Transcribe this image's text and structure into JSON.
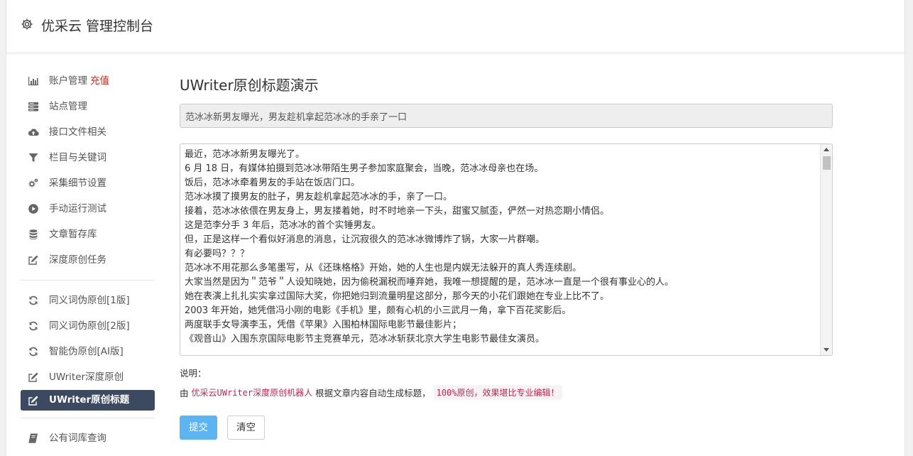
{
  "header": {
    "title": "优采云 管理控制台",
    "icon": "gear-icon"
  },
  "sidebar": {
    "items": [
      {
        "label": "账户管理",
        "tag": "充值",
        "icon": "bar-chart-icon"
      },
      {
        "label": "站点管理",
        "icon": "server-icon"
      },
      {
        "label": "接口文件相关",
        "icon": "cloud-upload-icon"
      },
      {
        "label": "栏目与关键词",
        "icon": "filter-icon"
      },
      {
        "label": "采集细节设置",
        "icon": "cogs-icon"
      },
      {
        "label": "手动运行测试",
        "icon": "play-circle-icon"
      },
      {
        "label": "文章暂存库",
        "icon": "database-icon"
      },
      {
        "label": "深度原创任务",
        "icon": "edit-icon"
      }
    ],
    "items2": [
      {
        "label": "同义词伪原创[1版]",
        "icon": "refresh-icon"
      },
      {
        "label": "同义词伪原创[2版]",
        "icon": "refresh-icon"
      },
      {
        "label": "智能伪原创[AI版]",
        "icon": "refresh-icon"
      },
      {
        "label": "UWriter深度原创",
        "icon": "edit-icon"
      },
      {
        "label": "UWriter原创标题",
        "icon": "edit-icon",
        "active": true
      }
    ],
    "items3": [
      {
        "label": "公有词库查询",
        "icon": "book-icon"
      }
    ]
  },
  "main": {
    "page_title": "UWriter原创标题演示",
    "generated_title": "范冰冰新男友曝光，男友趁机拿起范冰冰的手亲了一口",
    "content_lines": [
      "最近，范冰冰新男友曝光了。",
      "6 月 18 日，有媒体拍摄到范冰冰带陌生男子参加家庭聚会，当晚，范冰冰母亲也在场。",
      "饭后，范冰冰牵着男友的手站在饭店门口。",
      "范冰冰摸了摸男友的肚子，男友趁机拿起范冰冰的手，亲了一口。",
      "接着，范冰冰依偎在男友身上，男友搂着她，时不时地亲一下头，甜蜜又腻歪，俨然一对热恋期小情侣。",
      "这是范李分手 3 年后，范冰冰的首个实锤男友。",
      "但，正是这样一个看似好消息的消息，让沉寂很久的范冰冰微博炸了锅，大家一片群嘲。",
      "有必要吗？？？",
      "范冰冰不用花那么多笔墨写，从《还珠格格》开始，她的人生也是内娱无法躲开的真人秀连续剧。",
      "大家当然是因为＂范爷＂人设知晓她，因为偷税漏税而唾弃她，我唯一想提醒的是，范冰冰一直是一个很有事业心的人。",
      "她在表演上扎扎实实拿过国际大奖，你把她归到流量明星这部分，那今天的小花们跟她在专业上比不了。",
      "2003 年开始，她凭借冯小刚的电影《手机》里，颇有心机的小三武月一角，拿下百花奖影后。",
      "两度联手女导演李玉，凭借《苹果》入围柏林国际电影节最佳影片；",
      "《观音山》入围东京国际电影节主竞赛单元，范冰冰斩获北京大学生电影节最佳女演员。"
    ],
    "note_label": "说明：",
    "note_prefix": "由",
    "note_code1": "优采云UWriter深度原创机器人",
    "note_middle": "根据文章内容自动生成标题，",
    "note_code2": "100%原创，效果堪比专业编辑！",
    "submit_label": "提交",
    "clear_label": "清空"
  },
  "colors": {
    "active_bg": "#3b4a60",
    "primary": "#5bb5f2",
    "tag_red": "#d9251d",
    "code_red": "#c7254e"
  }
}
